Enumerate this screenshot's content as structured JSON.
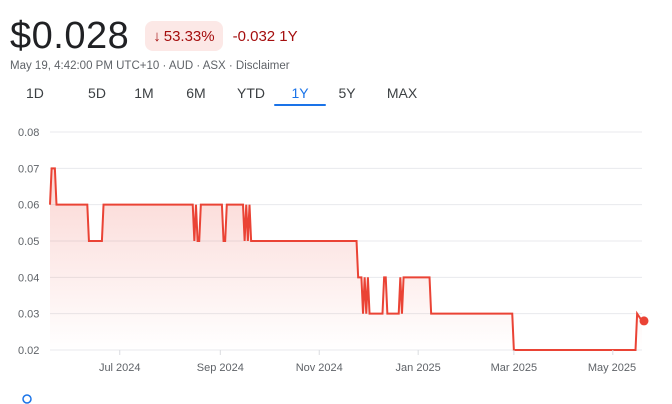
{
  "header": {
    "price": "$0.028",
    "percent_change": "53.33%",
    "abs_change": "-0.032 1Y",
    "change_direction_icon": "arrow-down-icon"
  },
  "meta": "May 19, 4:42:00 PM UTC+10 · AUD · ASX · Disclaimer",
  "tabs": [
    {
      "label": "1D",
      "active": false
    },
    {
      "label": "5D",
      "active": false
    },
    {
      "label": "1M",
      "active": false
    },
    {
      "label": "6M",
      "active": false
    },
    {
      "label": "YTD",
      "active": false
    },
    {
      "label": "1Y",
      "active": true
    },
    {
      "label": "5Y",
      "active": false
    },
    {
      "label": "MAX",
      "active": false
    }
  ],
  "colors": {
    "line": "#ea4335",
    "negative_text": "#a50e0e",
    "negative_bg": "#fce8e6",
    "active_tab": "#1a73e8",
    "grid": "#e8eaed"
  },
  "chart_data": {
    "type": "line",
    "title": "",
    "xlabel": "",
    "ylabel": "",
    "ylim": [
      0.02,
      0.08
    ],
    "yticks": [
      0.08,
      0.07,
      0.06,
      0.05,
      0.04,
      0.03,
      0.02
    ],
    "xtick_labels": [
      "Jul 2024",
      "Sep 2024",
      "Nov 2024",
      "Jan 2025",
      "Mar 2025",
      "May 2025"
    ],
    "xtick_dates": [
      "2024-07-01",
      "2024-09-01",
      "2024-11-01",
      "2025-01-01",
      "2025-03-01",
      "2025-05-01"
    ],
    "xlim": [
      "2024-05-19",
      "2025-05-19"
    ],
    "grid": true,
    "legend": "none",
    "series": [
      {
        "x": [
          "2024-05-19",
          "2024-05-20",
          "2024-05-22",
          "2024-05-23",
          "2024-06-11",
          "2024-06-12",
          "2024-06-20",
          "2024-06-21",
          "2024-08-15",
          "2024-08-16",
          "2024-08-17",
          "2024-08-18",
          "2024-08-19",
          "2024-08-20",
          "2024-09-02",
          "2024-09-03",
          "2024-09-04",
          "2024-09-05",
          "2024-09-15",
          "2024-09-16",
          "2024-09-17",
          "2024-09-18",
          "2024-09-19",
          "2024-09-20",
          "2024-11-24",
          "2024-11-25",
          "2024-11-27",
          "2024-11-28",
          "2024-11-29",
          "2024-11-30",
          "2024-12-01",
          "2024-12-02",
          "2024-12-03",
          "2024-12-04",
          "2024-12-10",
          "2024-12-11",
          "2024-12-12",
          "2024-12-13",
          "2024-12-20",
          "2024-12-21",
          "2024-12-22",
          "2024-12-23",
          "2024-12-25",
          "2024-12-26",
          "2025-01-08",
          "2025-01-09",
          "2025-02-28",
          "2025-03-01",
          "2025-05-15",
          "2025-05-16",
          "2025-05-19"
        ],
        "values": [
          0.06,
          0.07,
          0.07,
          0.06,
          0.06,
          0.05,
          0.05,
          0.06,
          0.06,
          0.05,
          0.06,
          0.05,
          0.05,
          0.06,
          0.06,
          0.05,
          0.05,
          0.06,
          0.06,
          0.05,
          0.06,
          0.05,
          0.06,
          0.05,
          0.05,
          0.04,
          0.04,
          0.03,
          0.04,
          0.03,
          0.04,
          0.03,
          0.03,
          0.03,
          0.03,
          0.04,
          0.04,
          0.03,
          0.03,
          0.04,
          0.03,
          0.04,
          0.04,
          0.04,
          0.04,
          0.03,
          0.03,
          0.02,
          0.02,
          0.03,
          0.028
        ]
      }
    ]
  }
}
